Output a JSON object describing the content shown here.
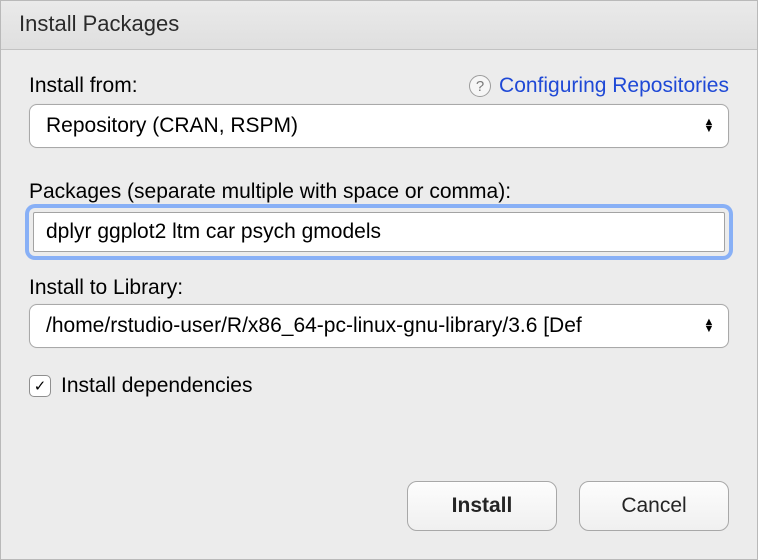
{
  "title": "Install Packages",
  "help": {
    "linkText": "Configuring Repositories"
  },
  "installFrom": {
    "label": "Install from:",
    "value": "Repository (CRAN, RSPM)"
  },
  "packages": {
    "label": "Packages (separate multiple with space or comma):",
    "value": "dplyr ggplot2 ltm car psych gmodels"
  },
  "library": {
    "label": "Install to Library:",
    "value": "/home/rstudio-user/R/x86_64-pc-linux-gnu-library/3.6 [Def"
  },
  "dependencies": {
    "label": "Install dependencies",
    "checked": true
  },
  "buttons": {
    "install": "Install",
    "cancel": "Cancel"
  }
}
